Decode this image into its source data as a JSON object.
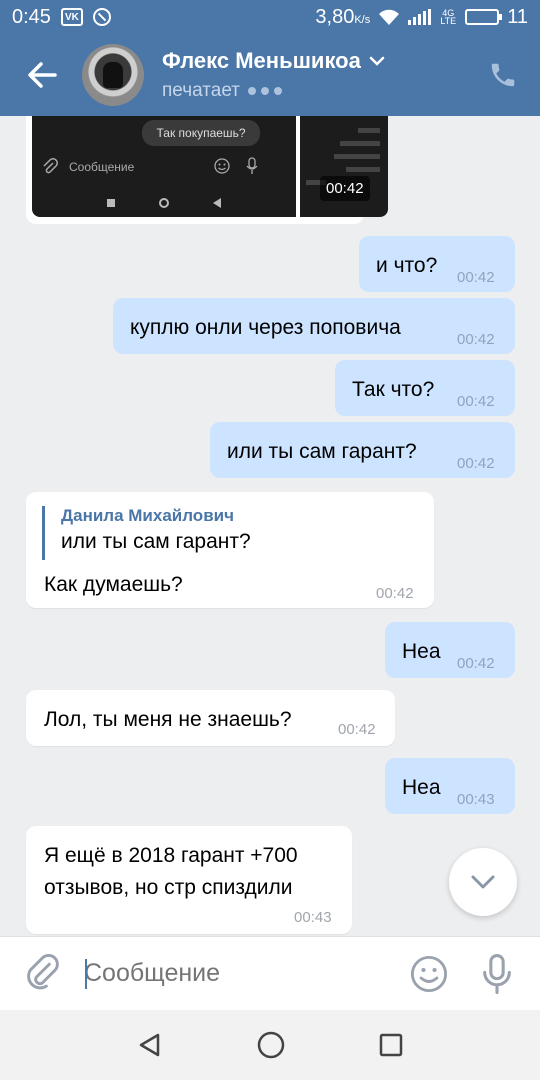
{
  "status_bar": {
    "time": "0:45",
    "speed": "3,80",
    "speed_unit": "K/s",
    "network": "4G LTE",
    "battery": "11"
  },
  "header": {
    "contact_name": "Флекс Меньшикоа",
    "contact_status": "печатает"
  },
  "preview": {
    "screenshot_prompt": "Так покупаешь?",
    "screenshot_input": "Сообщение",
    "duration": "00:42"
  },
  "messages": [
    {
      "dir": "out",
      "text": "и что?",
      "time": "00:42"
    },
    {
      "dir": "out",
      "text": "куплю онли через поповича",
      "time": "00:42"
    },
    {
      "dir": "out",
      "text": "Так что?",
      "time": "00:42"
    },
    {
      "dir": "out",
      "text": "или ты сам гарант?",
      "time": "00:42"
    },
    {
      "dir": "in",
      "reply_author": "Данила Михайлович",
      "reply_text": "или ты сам гарант?",
      "text": "Как думаешь?",
      "time": "00:42"
    },
    {
      "dir": "out",
      "text": "Неа",
      "time": "00:42"
    },
    {
      "dir": "in",
      "text": "Лол, ты меня не знаешь?",
      "time": "00:42"
    },
    {
      "dir": "out",
      "text": "Неа",
      "time": "00:43"
    },
    {
      "dir": "in",
      "line1": "Я ещё в 2018 гарант +700",
      "line2": "отзывов, но стр спиздили",
      "time": "00:43"
    }
  ],
  "composer": {
    "placeholder": "Сообщение"
  },
  "colors": {
    "brand": "#4a76a8",
    "outgoing_bubble": "#cce4ff",
    "incoming_bubble": "#ffffff",
    "background": "#edeef0"
  },
  "icons": [
    "back-arrow-icon",
    "chevron-down-icon",
    "phone-icon",
    "attach-icon",
    "emoji-icon",
    "microphone-icon",
    "chevron-down-icon",
    "nav-back-icon",
    "nav-home-icon",
    "nav-recents-icon"
  ]
}
